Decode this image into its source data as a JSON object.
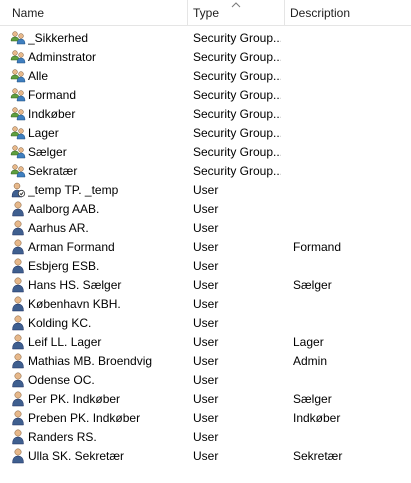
{
  "columns": {
    "name": "Name",
    "type": "Type",
    "description": "Description"
  },
  "rows": [
    {
      "name": "_Sikkerhed",
      "type": "Security Group...",
      "description": "",
      "icon": "group-icon"
    },
    {
      "name": "Adminstrator",
      "type": "Security Group...",
      "description": "",
      "icon": "group-icon"
    },
    {
      "name": "Alle",
      "type": "Security Group...",
      "description": "",
      "icon": "group-icon"
    },
    {
      "name": "Formand",
      "type": "Security Group...",
      "description": "",
      "icon": "group-icon"
    },
    {
      "name": "Indkøber",
      "type": "Security Group...",
      "description": "",
      "icon": "group-icon"
    },
    {
      "name": "Lager",
      "type": "Security Group...",
      "description": "",
      "icon": "group-icon"
    },
    {
      "name": "Sælger",
      "type": "Security Group...",
      "description": "",
      "icon": "group-icon"
    },
    {
      "name": "Sekratær",
      "type": "Security Group...",
      "description": "",
      "icon": "group-icon"
    },
    {
      "name": "_temp TP. _temp",
      "type": "User",
      "description": "",
      "icon": "disabled-user-icon"
    },
    {
      "name": "Aalborg AAB.",
      "type": "User",
      "description": "",
      "icon": "user-icon"
    },
    {
      "name": "Aarhus AR.",
      "type": "User",
      "description": "",
      "icon": "user-icon"
    },
    {
      "name": "Arman Formand",
      "type": "User",
      "description": "Formand",
      "icon": "user-icon"
    },
    {
      "name": "Esbjerg ESB.",
      "type": "User",
      "description": "",
      "icon": "user-icon"
    },
    {
      "name": "Hans HS. Sælger",
      "type": "User",
      "description": "Sælger",
      "icon": "user-icon"
    },
    {
      "name": "København KBH.",
      "type": "User",
      "description": "",
      "icon": "user-icon"
    },
    {
      "name": "Kolding KC.",
      "type": "User",
      "description": "",
      "icon": "user-icon"
    },
    {
      "name": "Leif LL. Lager",
      "type": "User",
      "description": "Lager",
      "icon": "user-icon"
    },
    {
      "name": "Mathias MB. Broendvig",
      "type": "User",
      "description": "Admin",
      "icon": "user-icon"
    },
    {
      "name": "Odense OC.",
      "type": "User",
      "description": "",
      "icon": "user-icon"
    },
    {
      "name": "Per PK. Indkøber",
      "type": "User",
      "description": "Sælger",
      "icon": "user-icon"
    },
    {
      "name": "Preben PK. Indkøber",
      "type": "User",
      "description": "Indkøber",
      "icon": "user-icon"
    },
    {
      "name": "Randers RS.",
      "type": "User",
      "description": "",
      "icon": "user-icon"
    },
    {
      "name": "Ulla SK. Sekretær",
      "type": "User",
      "description": "Sekretær",
      "icon": "user-icon"
    }
  ],
  "colors": {
    "header_border": "#e5e5e5",
    "text": "#000000",
    "user_body": "#3f5f8f",
    "user_skin": "#e7b88a",
    "group_green": "#5f9f3f"
  }
}
